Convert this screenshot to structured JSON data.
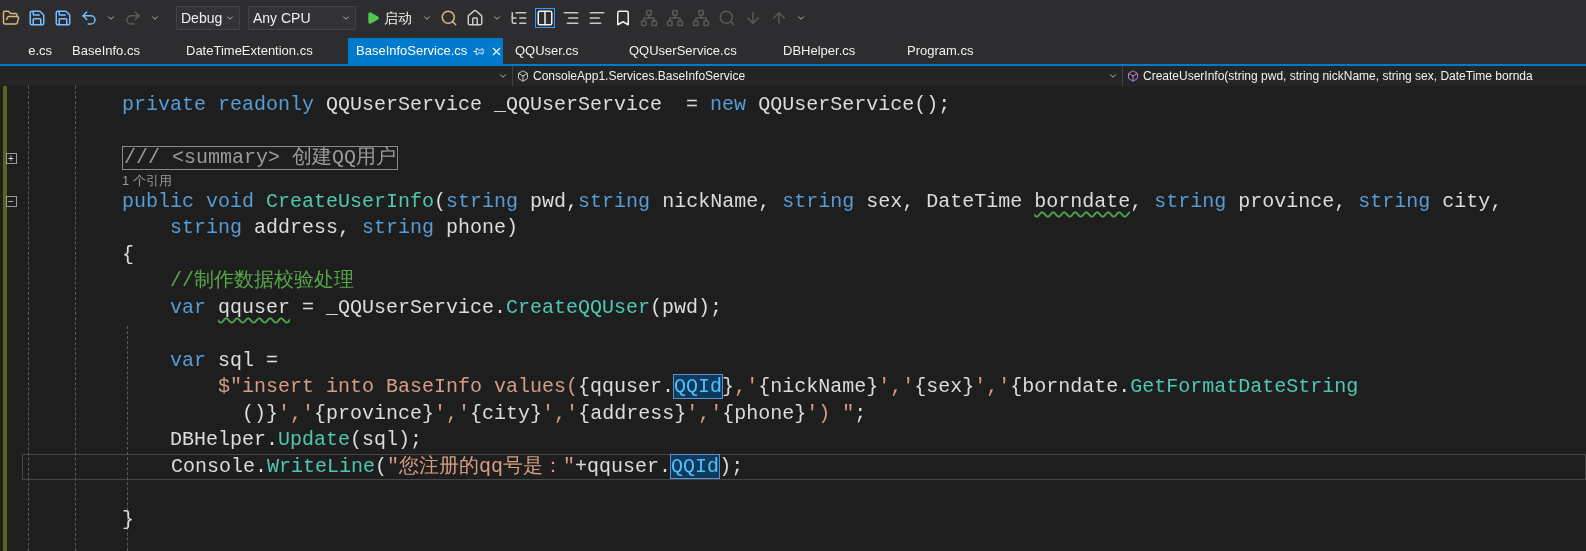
{
  "toolbar": {
    "redo": {
      "disabled": true
    },
    "configuration": "Debug",
    "platform": "Any CPU",
    "start_label": "启动"
  },
  "tabs": [
    {
      "label": "e.cs",
      "selected": false
    },
    {
      "label": "BaseInfo.cs",
      "selected": false
    },
    {
      "label": "DateTimeExtention.cs",
      "selected": false
    },
    {
      "label": "BaseInfoService.cs",
      "selected": true
    },
    {
      "label": "QQUser.cs",
      "selected": false
    },
    {
      "label": "QQUserService.cs",
      "selected": false
    },
    {
      "label": "DBHelper.cs",
      "selected": false
    },
    {
      "label": "Program.cs",
      "selected": false
    }
  ],
  "navigation_bar": {
    "class_dropdown": "ConsoleApp1.Services.BaseInfoService",
    "member_dropdown": "CreateUserInfo(string pwd, string nickName, string sex, DateTime bornda"
  },
  "editor": {
    "lines": [
      {
        "kind": "code",
        "tokens": [
          {
            "t": "private readonly ",
            "kind": "keyword"
          },
          {
            "t": "QQUserService _QQUserService  = ",
            "kind": "plain"
          },
          {
            "t": "new ",
            "kind": "keyword"
          },
          {
            "t": "QQUserService();",
            "kind": "plain"
          }
        ]
      },
      {
        "kind": "blank"
      },
      {
        "kind": "collapsed",
        "fold": "+",
        "text": "/// <summary> 创建QQ用户"
      },
      {
        "kind": "codelens",
        "text": "1 个引用"
      },
      {
        "kind": "code",
        "fold": "−",
        "tokens": [
          {
            "t": "public void ",
            "kind": "keyword"
          },
          {
            "t": "CreateUserInfo",
            "kind": "method"
          },
          {
            "t": "(",
            "kind": "plain"
          },
          {
            "t": "string ",
            "kind": "keyword"
          },
          {
            "t": "pwd,",
            "kind": "plain"
          },
          {
            "t": "string ",
            "kind": "keyword"
          },
          {
            "t": "nickName, ",
            "kind": "plain"
          },
          {
            "t": "string ",
            "kind": "keyword"
          },
          {
            "t": "sex, DateTime ",
            "kind": "plain"
          },
          {
            "t": "borndate",
            "kind": "warning"
          },
          {
            "t": ", ",
            "kind": "plain"
          },
          {
            "t": "string ",
            "kind": "keyword"
          },
          {
            "t": "province, ",
            "kind": "plain"
          },
          {
            "t": "string ",
            "kind": "keyword"
          },
          {
            "t": "city,",
            "kind": "plain"
          }
        ]
      },
      {
        "kind": "code",
        "tokens": [
          {
            "t": "    string ",
            "kind": "keyword"
          },
          {
            "t": "address, ",
            "kind": "plain"
          },
          {
            "t": "string ",
            "kind": "keyword"
          },
          {
            "t": "phone)",
            "kind": "plain"
          }
        ]
      },
      {
        "kind": "code",
        "tokens": [
          {
            "t": "{",
            "kind": "plain"
          }
        ]
      },
      {
        "kind": "code",
        "tokens": [
          {
            "t": "    //制作数据校验处理",
            "kind": "comment"
          }
        ]
      },
      {
        "kind": "code",
        "tokens": [
          {
            "t": "    var ",
            "kind": "keyword"
          },
          {
            "t": "qquser",
            "kind": "warning"
          },
          {
            "t": " = _QQUserService.",
            "kind": "plain"
          },
          {
            "t": "CreateQQUser",
            "kind": "method"
          },
          {
            "t": "(pwd);",
            "kind": "plain"
          }
        ]
      },
      {
        "kind": "blank"
      },
      {
        "kind": "code",
        "tokens": [
          {
            "t": "    var ",
            "kind": "keyword"
          },
          {
            "t": "sql =",
            "kind": "plain"
          }
        ]
      },
      {
        "kind": "code",
        "tokens": [
          {
            "t": "        $\"insert into BaseInfo values(",
            "kind": "string"
          },
          {
            "t": "{qquser.",
            "kind": "plain"
          },
          {
            "t": "QQId",
            "kind": "highlight"
          },
          {
            "t": "}",
            "kind": "plain"
          },
          {
            "t": ",'",
            "kind": "string"
          },
          {
            "t": "{nickName}",
            "kind": "plain"
          },
          {
            "t": "','",
            "kind": "string"
          },
          {
            "t": "{sex}",
            "kind": "plain"
          },
          {
            "t": "','",
            "kind": "string"
          },
          {
            "t": "{borndate.",
            "kind": "plain"
          },
          {
            "t": "GetFormatDateString",
            "kind": "method"
          }
        ]
      },
      {
        "kind": "code",
        "tokens": [
          {
            "t": "          ()}",
            "kind": "plain"
          },
          {
            "t": "','",
            "kind": "string"
          },
          {
            "t": "{province}",
            "kind": "plain"
          },
          {
            "t": "','",
            "kind": "string"
          },
          {
            "t": "{city}",
            "kind": "plain"
          },
          {
            "t": "','",
            "kind": "string"
          },
          {
            "t": "{address}",
            "kind": "plain"
          },
          {
            "t": "','",
            "kind": "string"
          },
          {
            "t": "{phone}",
            "kind": "plain"
          },
          {
            "t": "') \"",
            "kind": "string"
          },
          {
            "t": ";",
            "kind": "plain"
          }
        ]
      },
      {
        "kind": "code",
        "tokens": [
          {
            "t": "    DBHelper.",
            "kind": "plain"
          },
          {
            "t": "Update",
            "kind": "method"
          },
          {
            "t": "(sql);",
            "kind": "plain"
          }
        ]
      },
      {
        "kind": "code",
        "current": true,
        "tokens": [
          {
            "t": "    Console.",
            "kind": "plain"
          },
          {
            "t": "WriteLine",
            "kind": "method"
          },
          {
            "t": "(",
            "kind": "plain"
          },
          {
            "t": "\"您注册的qq号是：\"",
            "kind": "string"
          },
          {
            "t": "+qquser.",
            "kind": "plain"
          },
          {
            "t": "QQId",
            "kind": "highlight"
          },
          {
            "t": ");",
            "kind": "plain"
          }
        ]
      },
      {
        "kind": "blank"
      },
      {
        "kind": "code",
        "tokens": [
          {
            "t": "}",
            "kind": "plain"
          }
        ]
      }
    ]
  }
}
